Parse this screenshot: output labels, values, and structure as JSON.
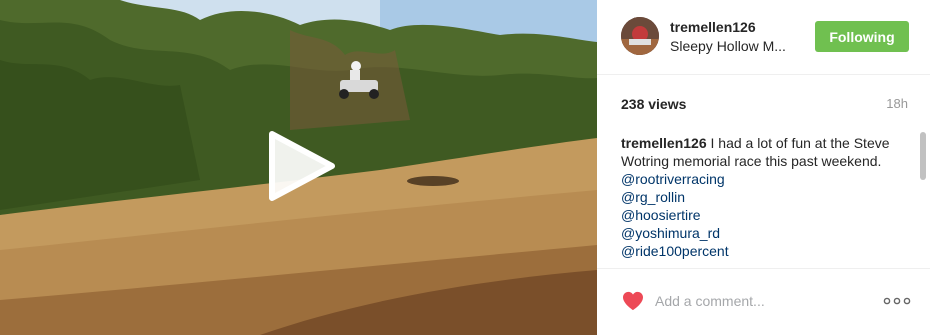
{
  "media": {
    "type": "video",
    "play_icon": "play-icon"
  },
  "header": {
    "username": "tremellen126",
    "location": "Sleepy Hollow M...",
    "follow_label": "Following",
    "follow_color": "#70c050"
  },
  "stats": {
    "views": "238 views",
    "time_ago": "18h"
  },
  "caption": {
    "username": "tremellen126",
    "text": "I had a lot of fun at the Steve Wotring memorial race this past weekend.",
    "mentions": [
      "@rootriverracing",
      "@rg_rollin",
      "@hoosiertire",
      "@yoshimura_rd",
      "@ride100percent"
    ]
  },
  "footer": {
    "comment_placeholder": "Add a comment...",
    "heart_icon": "heart-icon",
    "heart_color": "#ed4956",
    "more_icon": "more-options-icon"
  }
}
